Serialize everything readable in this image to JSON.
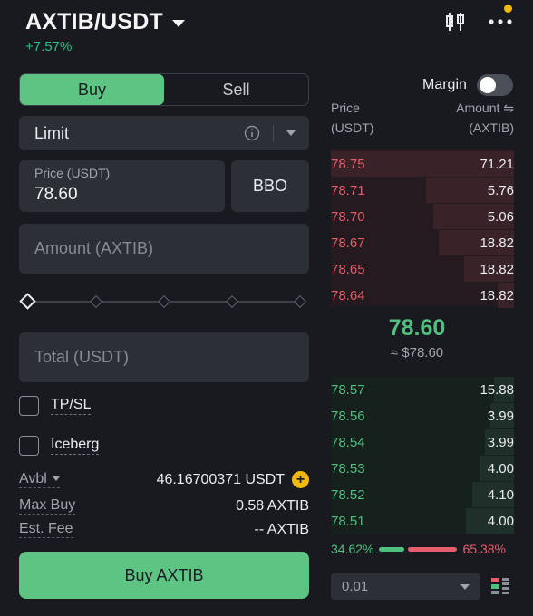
{
  "header": {
    "pair": "AXTIB/USDT",
    "change": "+7.57%"
  },
  "trade_side": {
    "buy": "Buy",
    "sell": "Sell",
    "active": "buy"
  },
  "order_type": {
    "label": "Limit"
  },
  "price_input": {
    "label": "Price (USDT)",
    "value": "78.60"
  },
  "bbo_label": "BBO",
  "amount_input": {
    "placeholder": "Amount (AXTIB)"
  },
  "total_input": {
    "placeholder": "Total (USDT)"
  },
  "options": {
    "tpsl": "TP/SL",
    "iceberg": "Iceberg"
  },
  "account": {
    "avbl_label": "Avbl",
    "avbl_value": "46.16700371 USDT",
    "maxbuy_label": "Max Buy",
    "maxbuy_value": "0.58 AXTIB",
    "fee_label": "Est. Fee",
    "fee_value": "-- AXTIB"
  },
  "cta": "Buy AXTIB",
  "margin": {
    "label": "Margin",
    "enabled": false
  },
  "orderbook": {
    "price_header_1": "Price",
    "price_header_2": "(USDT)",
    "amount_header_1": "Amount ⇋",
    "amount_header_2": "(AXTIB)",
    "asks": [
      {
        "price": "78.75",
        "amount": "71.21",
        "depth": 1.0
      },
      {
        "price": "78.71",
        "amount": "5.76",
        "depth": 0.48
      },
      {
        "price": "78.70",
        "amount": "5.06",
        "depth": 0.44
      },
      {
        "price": "78.67",
        "amount": "18.82",
        "depth": 0.41
      },
      {
        "price": "78.65",
        "amount": "18.82",
        "depth": 0.27
      },
      {
        "price": "78.64",
        "amount": "18.82",
        "depth": 0.09
      }
    ],
    "mid_price": "78.60",
    "mid_fiat": "≈ $78.60",
    "bids": [
      {
        "price": "78.57",
        "amount": "15.88",
        "depth": 0.11
      },
      {
        "price": "78.56",
        "amount": "3.99",
        "depth": 0.13
      },
      {
        "price": "78.54",
        "amount": "3.99",
        "depth": 0.16
      },
      {
        "price": "78.53",
        "amount": "4.00",
        "depth": 0.19
      },
      {
        "price": "78.52",
        "amount": "4.10",
        "depth": 0.23
      },
      {
        "price": "78.51",
        "amount": "4.00",
        "depth": 0.26
      }
    ],
    "buy_ratio": "34.62%",
    "sell_ratio": "65.38%",
    "precision": "0.01"
  },
  "colors": {
    "buy": "#5ec483",
    "sell": "#e65d6b",
    "accent": "#f0b90b",
    "background": "#181a20"
  }
}
